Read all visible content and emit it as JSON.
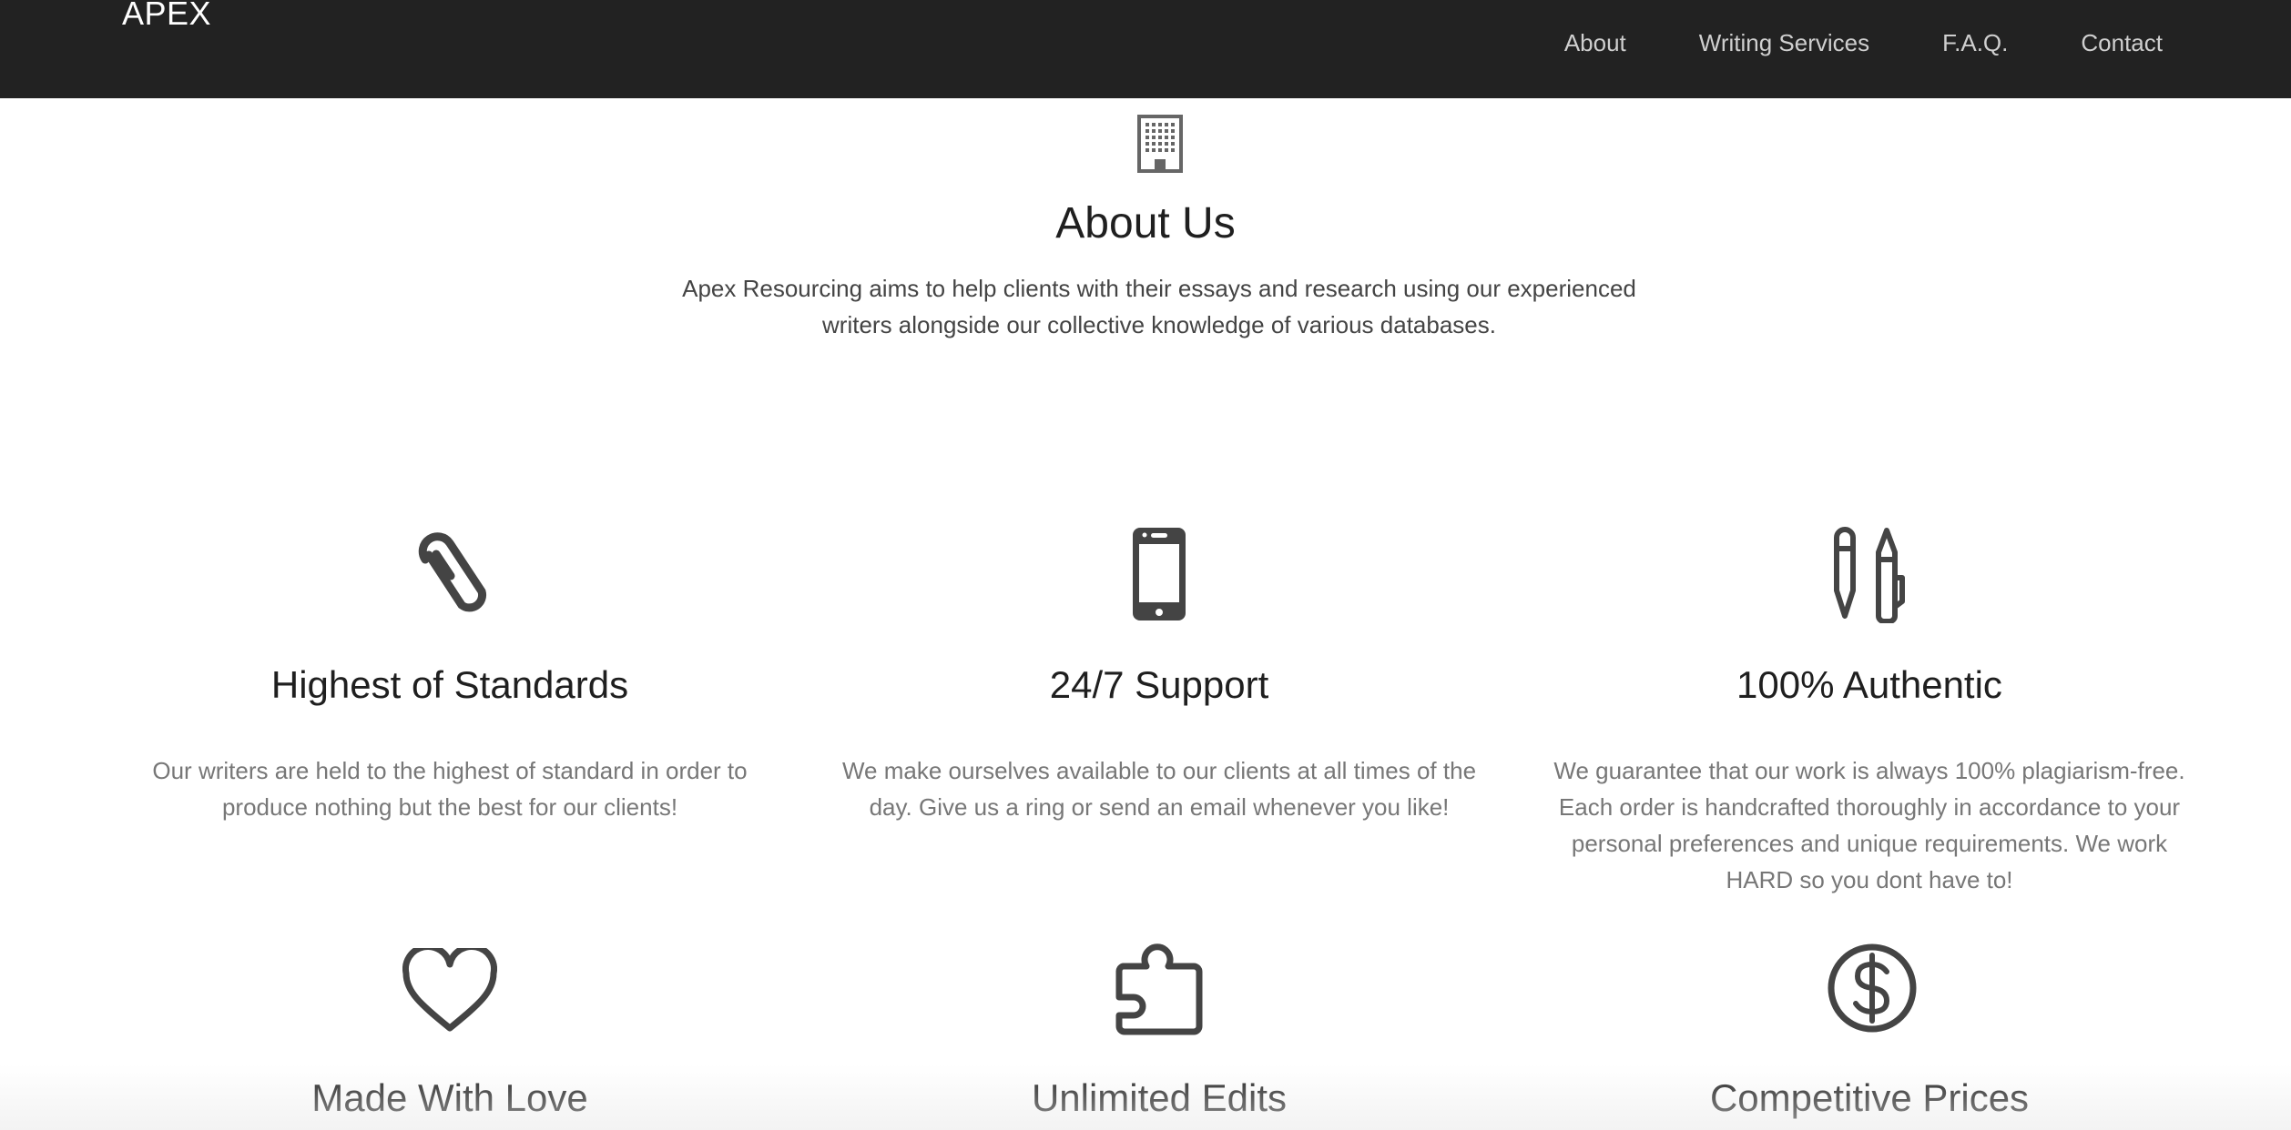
{
  "navbar": {
    "brand": "APEX",
    "links": [
      "About",
      "Writing Services",
      "F.A.Q.",
      "Contact"
    ]
  },
  "about": {
    "icon": "building-icon",
    "title": "About Us",
    "text": "Apex Resourcing aims to help clients with their essays and research using our experienced writers alongside our collective knowledge of various databases."
  },
  "features": [
    {
      "icon": "paperclip-icon",
      "title": "Highest of Standards",
      "text": "Our writers are held to the highest of standard in order to produce nothing but the best for our clients!"
    },
    {
      "icon": "smartphone-icon",
      "title": "24/7 Support",
      "text": "We make ourselves available to our clients at all times of the day. Give us a ring or send an email whenever you like!"
    },
    {
      "icon": "pencil-pen-icon",
      "title": "100% Authentic",
      "text": "We guarantee that our work is always 100% plagiarism-free. Each order is handcrafted thoroughly in accordance to your personal preferences and unique requirements. We work HARD so you dont have to!"
    },
    {
      "icon": "heart-icon",
      "title": "Made With Love",
      "text": ""
    },
    {
      "icon": "puzzle-piece-icon",
      "title": "Unlimited Edits",
      "text": ""
    },
    {
      "icon": "dollar-icon",
      "title": "Competitive Prices",
      "text": ""
    }
  ],
  "colors": {
    "navbar_bg": "#222222",
    "brand": "#ffffff",
    "nav_link": "#cfcfcf",
    "heading": "#1f1f1f",
    "body_text": "#777777",
    "icon": "#444444"
  }
}
